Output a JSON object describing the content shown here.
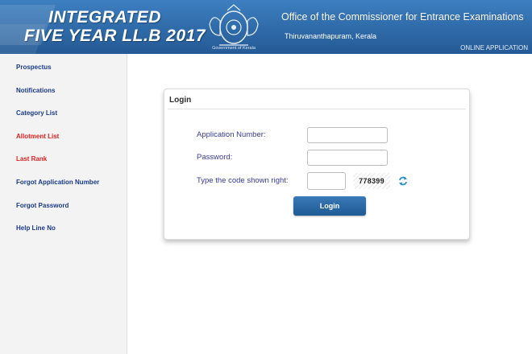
{
  "header": {
    "title_line1": "INTEGRATED",
    "title_line2": "FIVE YEAR LL.B 2017",
    "emblem_caption": "Government of Kerala",
    "office": "Office of the Commissioner for Entrance Examinations",
    "city": "Thiruvananthapuram, Kerala",
    "online_application": "ONLINE APPLICATION",
    "colors": {
      "banner": "#2f6aa8",
      "text": "#ffffff"
    }
  },
  "sidebar": {
    "items": [
      {
        "label": "Prospectus",
        "color": "#1a3a8a"
      },
      {
        "label": "Notifications",
        "color": "#1a3a8a"
      },
      {
        "label": "Category List",
        "color": "#1a3a8a"
      },
      {
        "label": "Allotment List",
        "color": "#e02020"
      },
      {
        "label": "Last Rank",
        "color": "#e02020"
      },
      {
        "label": "Forgot Application Number",
        "color": "#1a3a8a"
      },
      {
        "label": "Forgot Password",
        "color": "#1a3a8a"
      },
      {
        "label": "Help Line No",
        "color": "#1a3a8a"
      }
    ]
  },
  "login": {
    "title": "Login",
    "application_number_label": "Application Number:",
    "application_number_value": "",
    "password_label": "Password:",
    "password_value": "",
    "captcha_label": "Type the code shown right:",
    "captcha_value": "",
    "captcha_code": "778399",
    "refresh_icon": "refresh-icon",
    "submit_label": "Login",
    "colors": {
      "button": "#1f5a94",
      "label": "#3a3a9a"
    }
  }
}
